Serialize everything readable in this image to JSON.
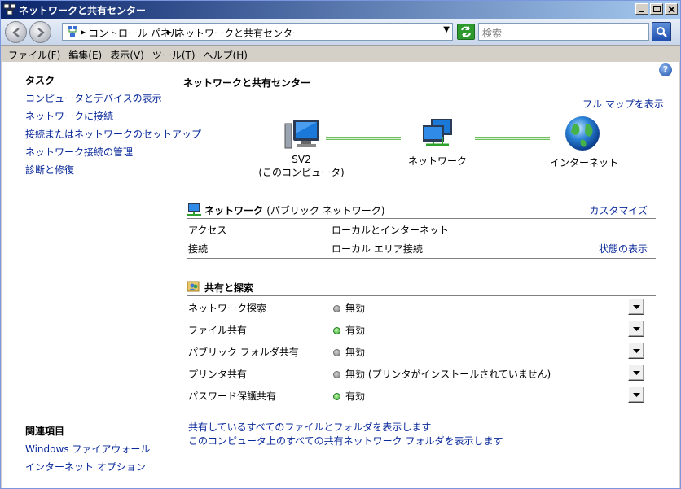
{
  "window": {
    "title": "ネットワークと共有センター"
  },
  "address": {
    "crumbs": [
      "コントロール パネル",
      "ネットワークと共有センター"
    ],
    "search_placeholder": "検索"
  },
  "menu": [
    "ファイル(F)",
    "編集(E)",
    "表示(V)",
    "ツール(T)",
    "ヘルプ(H)"
  ],
  "sidebar": {
    "tasks_title": "タスク",
    "tasks": [
      "コンピュータとデバイスの表示",
      "ネットワークに接続",
      "接続またはネットワークのセットアップ",
      "ネットワーク接続の管理",
      "診断と修復"
    ],
    "related_title": "関連項目",
    "related": [
      "Windows ファイアウォール",
      "インターネット オプション"
    ]
  },
  "main": {
    "title": "ネットワークと共有センター",
    "full_map": "フル マップを表示",
    "nodes": {
      "computer_name": "SV2",
      "computer_sub": "(このコンピュータ)",
      "network": "ネットワーク",
      "internet": "インターネット"
    },
    "network_section": {
      "title": "ネットワーク",
      "subtitle": "(パブリック ネットワーク)",
      "customize": "カスタマイズ",
      "rows": [
        {
          "key": "アクセス",
          "value": "ローカルとインターネット",
          "link": ""
        },
        {
          "key": "接続",
          "value": "ローカル エリア接続",
          "link": "状態の表示"
        }
      ]
    },
    "sharing_section": {
      "title": "共有と探索",
      "rows": [
        {
          "key": "ネットワーク探索",
          "status": "無効",
          "on": false
        },
        {
          "key": "ファイル共有",
          "status": "有効",
          "on": true
        },
        {
          "key": "パブリック フォルダ共有",
          "status": "無効",
          "on": false
        },
        {
          "key": "プリンタ共有",
          "status": "無効 (プリンタがインストールされていません)",
          "on": false
        },
        {
          "key": "パスワード保護共有",
          "status": "有効",
          "on": true
        }
      ]
    },
    "bottom_links": [
      "共有しているすべてのファイルとフォルダを表示します",
      "このコンピュータ上のすべての共有ネットワーク フォルダを表示します"
    ]
  },
  "colors": {
    "link": "#0a2a9a",
    "title_bar_start": "#0a246a",
    "title_bar_end": "#a6caf0"
  }
}
